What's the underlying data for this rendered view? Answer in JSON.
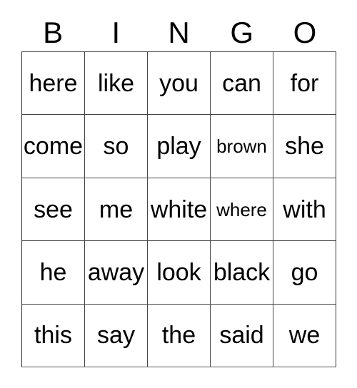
{
  "card": {
    "header": {
      "letters": [
        "B",
        "I",
        "N",
        "G",
        "O"
      ]
    },
    "columns": 5,
    "rows": 5,
    "grid": [
      [
        {
          "word": "here",
          "shrink": false
        },
        {
          "word": "like",
          "shrink": false
        },
        {
          "word": "you",
          "shrink": false
        },
        {
          "word": "can",
          "shrink": false
        },
        {
          "word": "for",
          "shrink": false
        }
      ],
      [
        {
          "word": "come",
          "shrink": false
        },
        {
          "word": "so",
          "shrink": false
        },
        {
          "word": "play",
          "shrink": false
        },
        {
          "word": "brown",
          "shrink": true
        },
        {
          "word": "she",
          "shrink": false
        }
      ],
      [
        {
          "word": "see",
          "shrink": false
        },
        {
          "word": "me",
          "shrink": false
        },
        {
          "word": "white",
          "shrink": false
        },
        {
          "word": "where",
          "shrink": true
        },
        {
          "word": "with",
          "shrink": false
        }
      ],
      [
        {
          "word": "he",
          "shrink": false
        },
        {
          "word": "away",
          "shrink": false
        },
        {
          "word": "look",
          "shrink": false
        },
        {
          "word": "black",
          "shrink": false
        },
        {
          "word": "go",
          "shrink": false
        }
      ],
      [
        {
          "word": "this",
          "shrink": false
        },
        {
          "word": "say",
          "shrink": false
        },
        {
          "word": "the",
          "shrink": false
        },
        {
          "word": "said",
          "shrink": false
        },
        {
          "word": "we",
          "shrink": false
        }
      ]
    ],
    "colors": {
      "background": "#ffffff",
      "text": "#000000",
      "grid_line": "#444444",
      "grid_border": "#333333"
    }
  }
}
